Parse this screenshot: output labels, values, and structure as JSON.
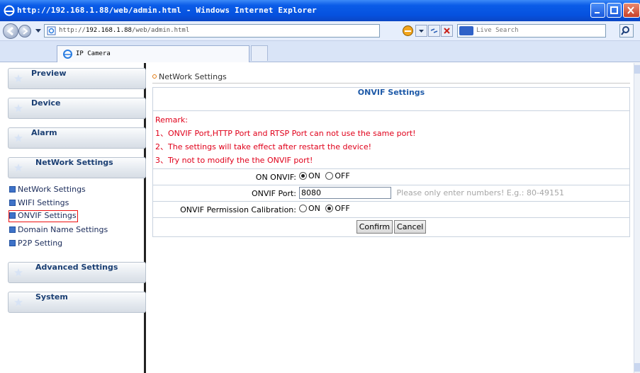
{
  "window": {
    "title": "http://192.168.1.88/web/admin.html - Windows Internet Explorer",
    "colors": {
      "titlebar": "#0a5ce8",
      "close_button": "#c9412a"
    }
  },
  "addressbar": {
    "url_prefix": "http://",
    "url_host": "192.168.1.88",
    "url_path": "/web/admin.html",
    "search_placeholder": "Live Search"
  },
  "tabs": [
    {
      "label": "IP Camera",
      "icon": "ie-page-icon"
    }
  ],
  "sidebar": {
    "menus": [
      {
        "label": "Preview"
      },
      {
        "label": "Device"
      },
      {
        "label": "Alarm"
      },
      {
        "label": "NetWork Settings"
      }
    ],
    "subitems": [
      {
        "label": "NetWork Settings",
        "active": false
      },
      {
        "label": "WIFI Settings",
        "active": false
      },
      {
        "label": "ONVIF Settings",
        "active": true
      },
      {
        "label": "Domain Name Settings",
        "active": false
      },
      {
        "label": "P2P Setting",
        "active": false
      }
    ],
    "menus_after": [
      {
        "label": "Advanced Settings"
      },
      {
        "label": "System"
      }
    ]
  },
  "main": {
    "breadcrumb": "NetWork Settings",
    "panel_title": "ONVIF Settings",
    "remark": {
      "heading": "Remark:",
      "lines": [
        "1、ONVIF Port,HTTP Port and RTSP Port can not use the same port!",
        "2、The settings will take effect after restart the device!",
        "3、Try not to modify the the ONVIF port!"
      ],
      "color": "#e0001a"
    },
    "on_onvif": {
      "label": "ON ONVIF:",
      "options": [
        "ON",
        "OFF"
      ],
      "selected": "ON"
    },
    "onvif_port": {
      "label": "ONVIF Port:",
      "value": "8080",
      "hint": "Please only enter numbers! E.g.: 80-49151"
    },
    "permission": {
      "label": "ONVIF Permission Calibration:",
      "options": [
        "ON",
        "OFF"
      ],
      "selected": "OFF"
    },
    "buttons": {
      "confirm": "Confirm",
      "cancel": "Cancel"
    }
  }
}
